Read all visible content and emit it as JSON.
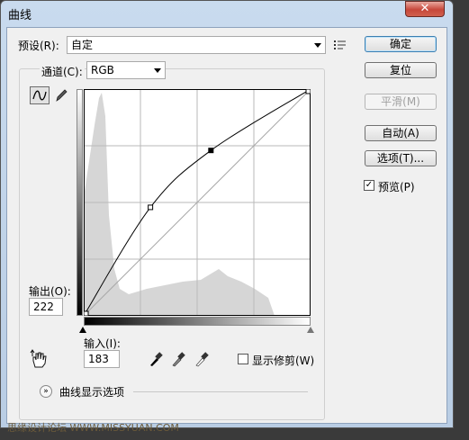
{
  "window": {
    "title": "曲线",
    "close_glyph": "✕"
  },
  "preset": {
    "label": "预设(R):",
    "value": "自定",
    "menu_icon": "list-menu-icon"
  },
  "channel": {
    "label": "通道(C):",
    "value": "RGB"
  },
  "buttons": {
    "ok": "确定",
    "reset": "复位",
    "smooth": "平滑(M)",
    "auto": "自动(A)",
    "options": "选项(T)..."
  },
  "preview": {
    "label": "预览(P)",
    "checked": true
  },
  "output": {
    "label": "输出(O):",
    "value": "222"
  },
  "input": {
    "label": "输入(I):",
    "value": "183"
  },
  "clipping": {
    "label": "显示修剪(W)",
    "checked": false
  },
  "curve_display_options": {
    "label": "曲线显示选项"
  },
  "watermark": {
    "text": "思缘设计论坛 WWW.MISSYUAN.COM"
  },
  "colors": {
    "dialog_bg": "#f0f0f0",
    "title_bar": "#c9dbee",
    "histogram": "#d6d6d6",
    "curve": "#000000"
  },
  "curve": {
    "points": [
      [
        0,
        0
      ],
      [
        75,
        122
      ],
      [
        143,
        186
      ],
      [
        255,
        255
      ]
    ],
    "selected_point": [
      143,
      186
    ]
  }
}
